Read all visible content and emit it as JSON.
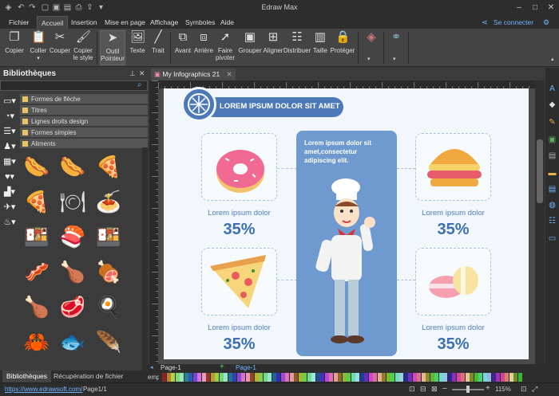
{
  "app": {
    "title": "Edraw Max",
    "connect": "Se connecter"
  },
  "menu": {
    "file": "Fichier",
    "tabs": [
      "Accueil",
      "Insertion",
      "Mise en page",
      "Affichage",
      "Symboles",
      "Aide"
    ]
  },
  "ribbon": {
    "copy": "Copier",
    "paste": "Coller",
    "cut": "Couper",
    "copy_style_1": "Copier",
    "copy_style_2": "le style",
    "pointer_1": "Outil",
    "pointer_2": "Pointeur",
    "text": "Texte",
    "line": "Trait",
    "front": "Avant",
    "back": "Arrière",
    "rotate_1": "Faire",
    "rotate_2": "pivoter",
    "group": "Grouper",
    "align": "Aligner",
    "distribute": "Distribuer",
    "size": "Taille",
    "protect": "Protéger"
  },
  "library": {
    "title": "Bibliothèques",
    "categories": [
      "Formes de flèche",
      "Titres",
      "Lignes droits design",
      "Formes simples",
      "Aliments"
    ],
    "bottom_tabs": [
      "Bibliothèques",
      "Récupération de fichier"
    ]
  },
  "document": {
    "tab": "My Infographics 21",
    "page_tab": "Page-1",
    "page_tab_active": "Page-1"
  },
  "infographic": {
    "banner": "LOREM IPSUM DOLOR SIT AMET",
    "center_text": "Lorem ipsum dolor sit amet,consectetur adipiscing elit.",
    "items": [
      {
        "label": "Lorem ipsum dolor",
        "value": "35%"
      },
      {
        "label": "Lorem ipsum dolor",
        "value": "35%"
      },
      {
        "label": "Lorem ipsum dolor",
        "value": "35%"
      },
      {
        "label": "Lorem ipsum dolor",
        "value": "35%"
      }
    ]
  },
  "status": {
    "url": "https://www.edrawsoft.com/",
    "page": "Page1/1",
    "zoom": "115%",
    "empty": "emp"
  }
}
